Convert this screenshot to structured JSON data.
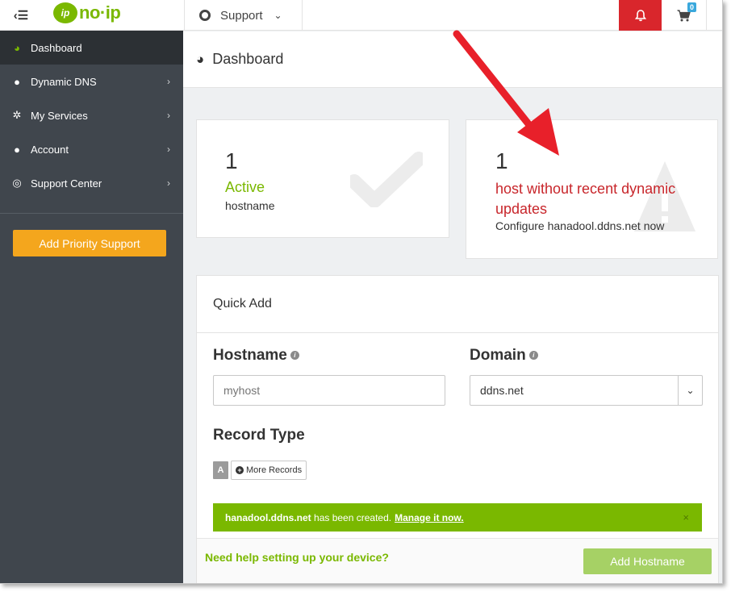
{
  "topbar": {
    "menu_toggle_icon": "sidebar-collapse-icon",
    "logo_mark": "ip",
    "logo_text": "no·ip",
    "support_label": "Support",
    "bell_icon": "bell-icon",
    "cart_icon": "cart-icon",
    "cart_count": "0",
    "alert_color": "#d9262c"
  },
  "sidebar": {
    "items": [
      {
        "label": "Dashboard",
        "icon": "dashboard-icon",
        "active": true
      },
      {
        "label": "Dynamic DNS",
        "icon": "globe-icon"
      },
      {
        "label": "My Services",
        "icon": "gear-icon"
      },
      {
        "label": "Account",
        "icon": "user-icon"
      },
      {
        "label": "Support Center",
        "icon": "lifering-icon"
      }
    ],
    "priority_button": "Add Priority Support",
    "priority_color": "#f4a61d"
  },
  "page": {
    "title": "Dashboard"
  },
  "cards": {
    "active": {
      "count": "1",
      "status": "Active",
      "subtitle": "hostname"
    },
    "warning": {
      "count": "1",
      "status": "host without recent dynamic updates",
      "subtitle": "Configure hanadool.ddns.net now"
    }
  },
  "quick_add": {
    "title": "Quick Add",
    "hostname_label": "Hostname",
    "hostname_placeholder": "myhost",
    "domain_label": "Domain",
    "domain_value": "ddns.net",
    "record_type_label": "Record Type",
    "record_a": "A",
    "more_records": "More Records",
    "alert": {
      "hostname": "hanadool.ddns.net",
      "message": "has been created.",
      "link": "Manage it now.",
      "close": "×"
    },
    "help_link": "Need help setting up your device?",
    "add_button": "Add Hostname"
  },
  "colors": {
    "brand_green": "#7ab800",
    "sidebar_bg": "#40464d",
    "warning_red": "#c8262b",
    "annotation_arrow": "#e8202a"
  }
}
